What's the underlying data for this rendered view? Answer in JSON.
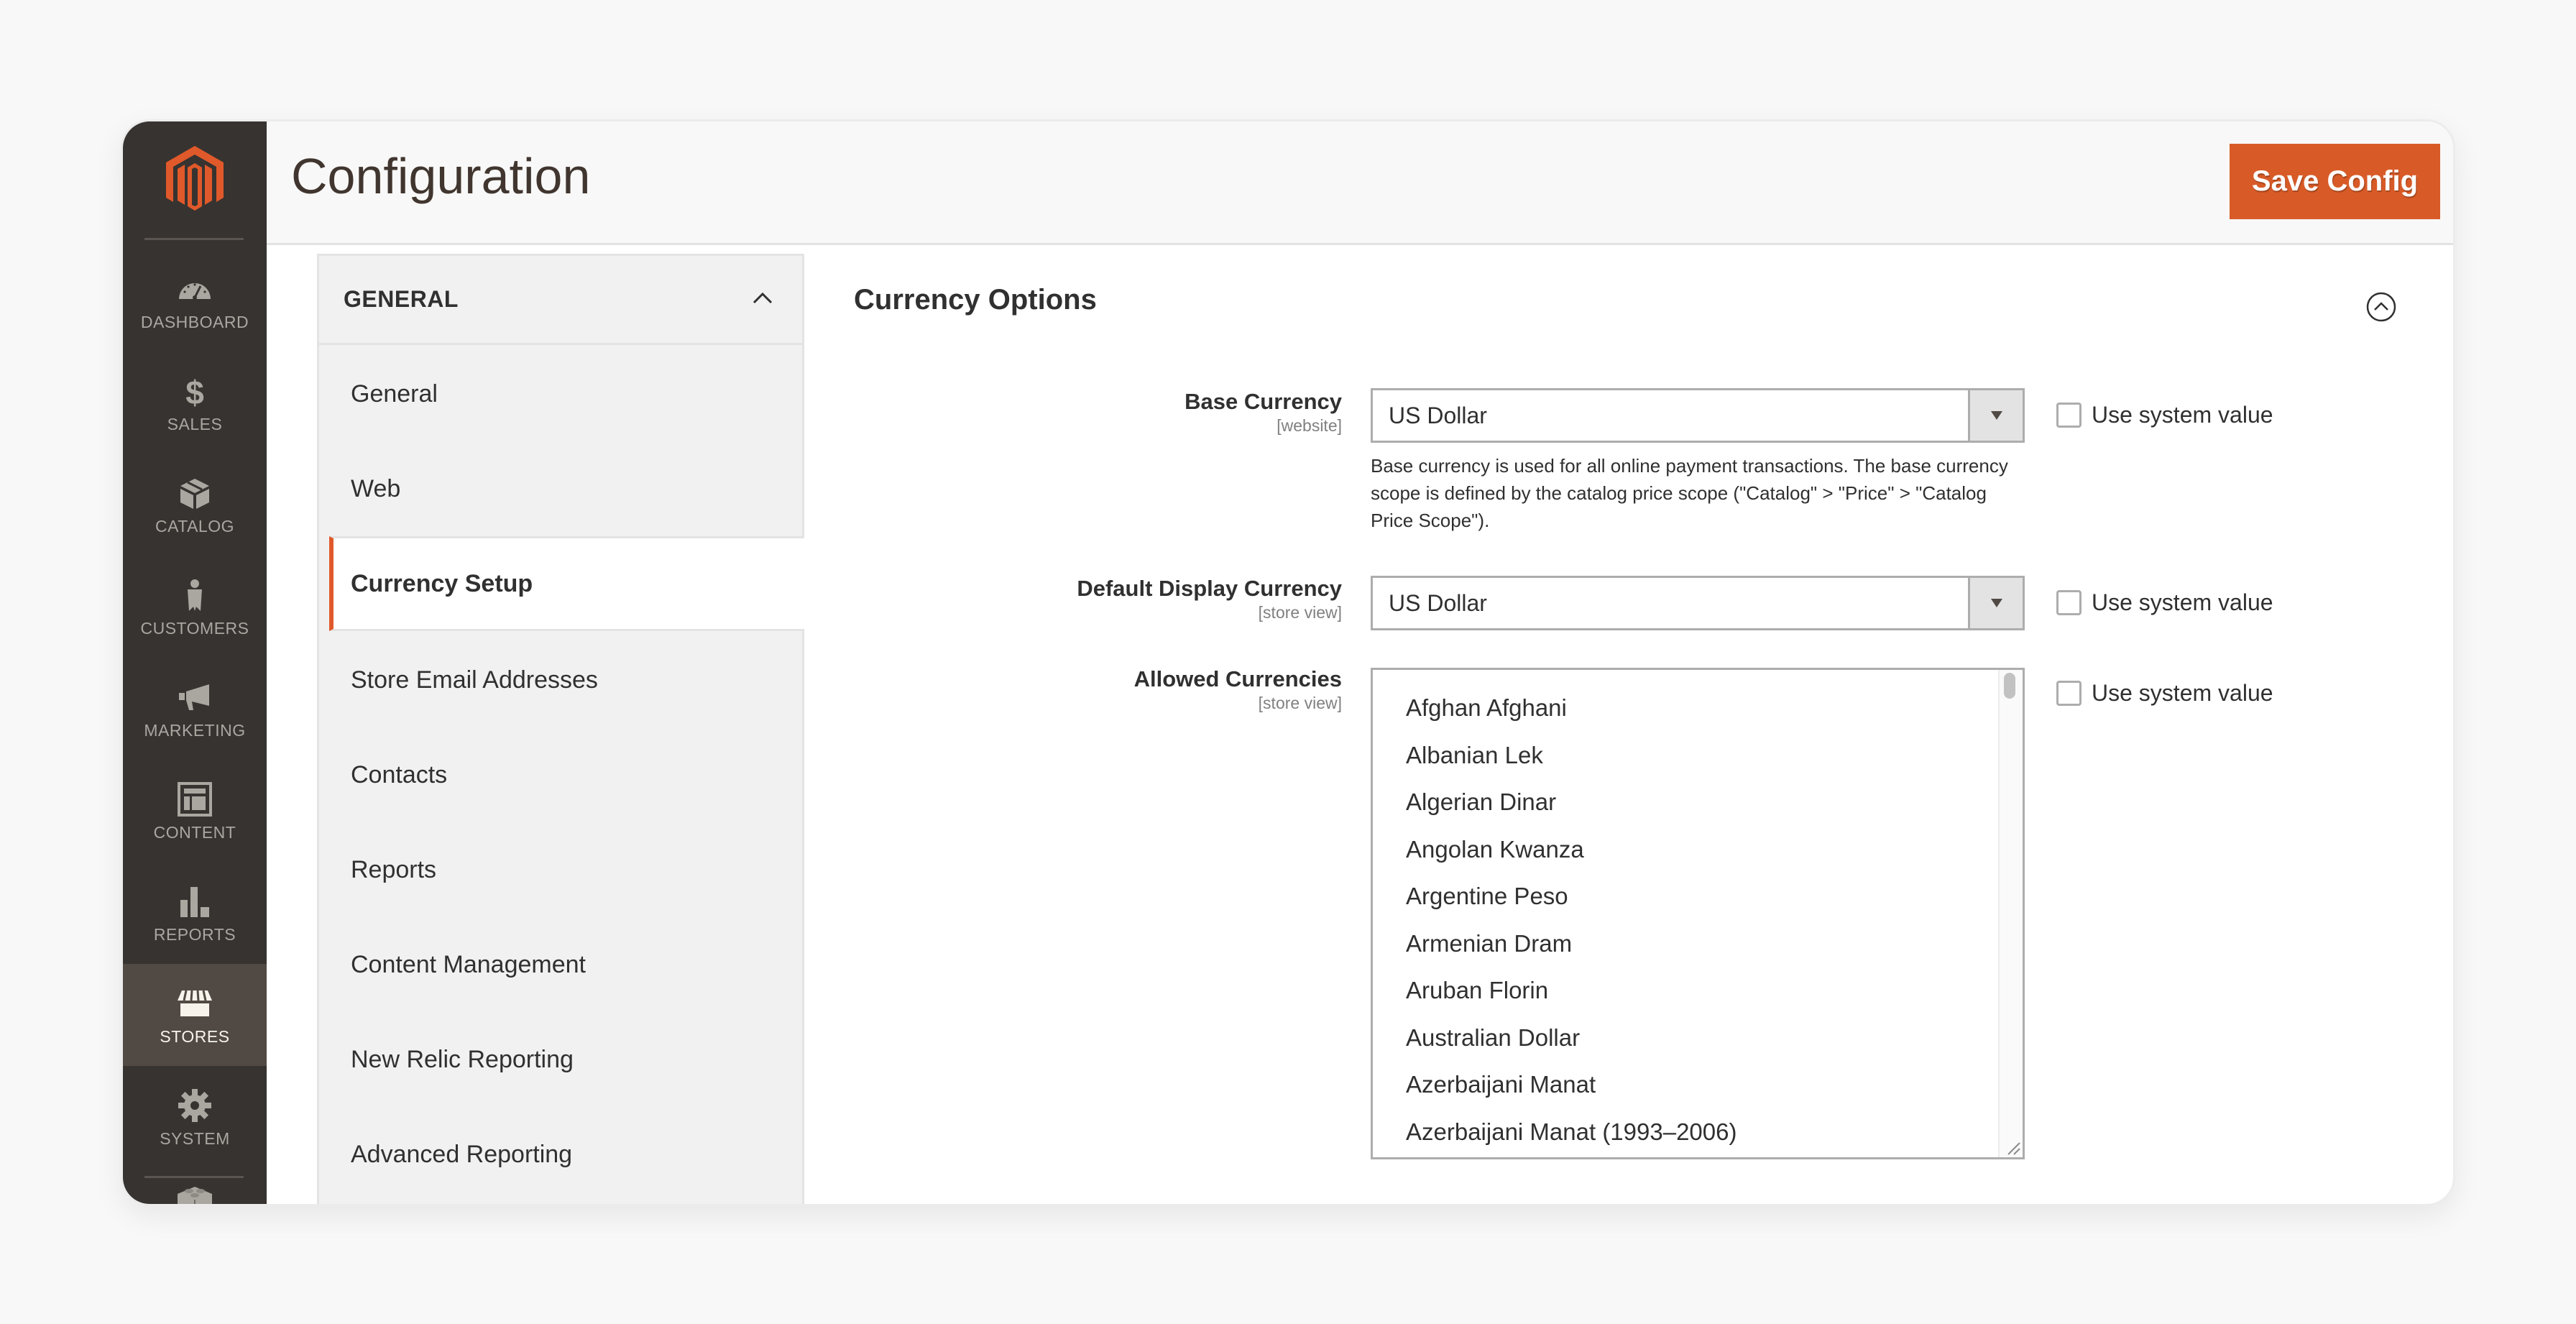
{
  "brand": {
    "logo_icon": "magento-logo-icon",
    "accent_color": "#e0592a",
    "sidebar_bg": "#373330"
  },
  "sidebar": {
    "items": [
      {
        "label": "Dashboard",
        "icon": "dashboard-gauge-icon",
        "active": false
      },
      {
        "label": "Sales",
        "icon": "dollar-icon",
        "active": false
      },
      {
        "label": "Catalog",
        "icon": "box-icon",
        "active": false
      },
      {
        "label": "Customers",
        "icon": "person-icon",
        "active": false
      },
      {
        "label": "Marketing",
        "icon": "megaphone-icon",
        "active": false
      },
      {
        "label": "Content",
        "icon": "layout-icon",
        "active": false
      },
      {
        "label": "Reports",
        "icon": "bar-chart-icon",
        "active": false
      },
      {
        "label": "Stores",
        "icon": "storefront-icon",
        "active": true
      },
      {
        "label": "System",
        "icon": "gear-icon",
        "active": false
      }
    ],
    "extra_icon": "extensions-lego-icon"
  },
  "header": {
    "title": "Configuration",
    "save_label": "Save Config"
  },
  "config_nav": {
    "group_title": "GENERAL",
    "group_expanded": true,
    "items": [
      {
        "label": "General",
        "active": false
      },
      {
        "label": "Web",
        "active": false
      },
      {
        "label": "Currency Setup",
        "active": true
      },
      {
        "label": "Store Email Addresses",
        "active": false
      },
      {
        "label": "Contacts",
        "active": false
      },
      {
        "label": "Reports",
        "active": false
      },
      {
        "label": "Content Management",
        "active": false
      },
      {
        "label": "New Relic Reporting",
        "active": false
      },
      {
        "label": "Advanced Reporting",
        "active": false
      }
    ]
  },
  "section": {
    "title": "Currency Options",
    "fields": {
      "base_currency": {
        "label": "Base Currency",
        "scope": "[website]",
        "value": "US Dollar",
        "hint": "Base currency is used for all online payment transactions. The base currency scope is defined by the catalog price scope (\"Catalog\" > \"Price\" > \"Catalog Price Scope\").",
        "use_system_value_label": "Use system value",
        "use_system_value": false
      },
      "default_display_currency": {
        "label": "Default Display Currency",
        "scope": "[store view]",
        "value": "US Dollar",
        "use_system_value_label": "Use system value",
        "use_system_value": false
      },
      "allowed_currencies": {
        "label": "Allowed Currencies",
        "scope": "[store view]",
        "options": [
          "Afghan Afghani",
          "Albanian Lek",
          "Algerian Dinar",
          "Angolan Kwanza",
          "Argentine Peso",
          "Armenian Dram",
          "Aruban Florin",
          "Australian Dollar",
          "Azerbaijani Manat",
          "Azerbaijani Manat (1993–2006)"
        ],
        "use_system_value_label": "Use system value",
        "use_system_value": false
      }
    }
  }
}
